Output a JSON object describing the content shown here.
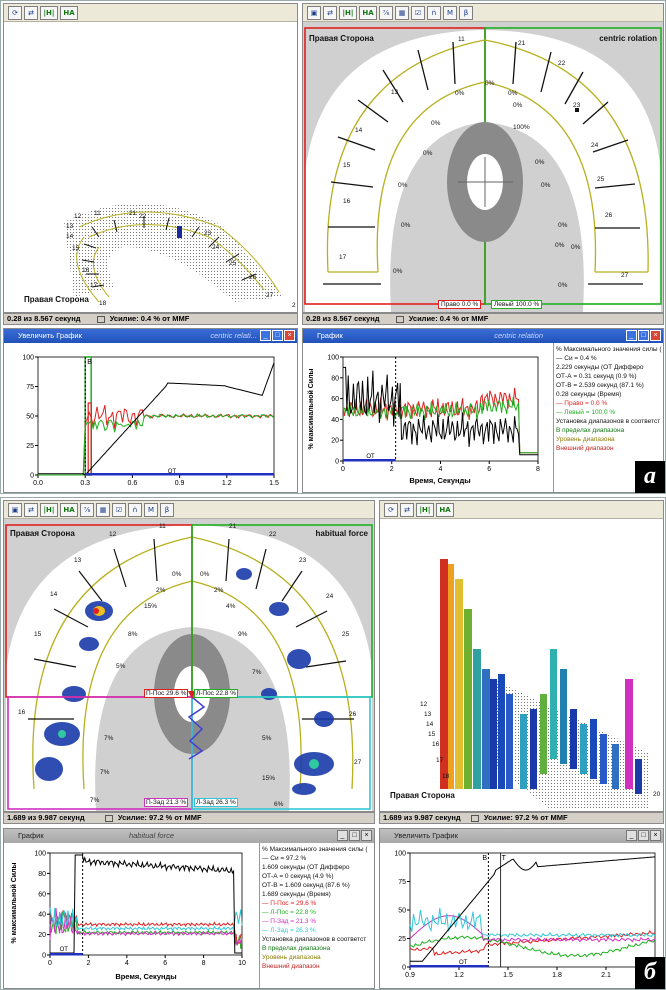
{
  "a": {
    "left_toolbar": [
      "⟳",
      "⇄",
      "|H|",
      "HA"
    ],
    "right_toolbar": [
      "▣",
      "⇄",
      "|H|",
      "HA",
      "⅞",
      "▦",
      "☑",
      "ṅ",
      "M",
      "β"
    ],
    "arch3d_label": "Правая Сторона",
    "arch3d_teeth": [
      "12",
      "11",
      "21",
      "22",
      "13",
      "23",
      "14",
      "24",
      "15",
      "25",
      "16",
      "26",
      "17",
      "27",
      "18"
    ],
    "arch3d_corner_num": "2",
    "arch_left_label": "Правая Сторона",
    "arch_right_label": "centric rolation",
    "arch_teeth": [
      "11",
      "21",
      "22",
      "13",
      "23",
      "14",
      "24",
      "15",
      "25",
      "16",
      "26",
      "17",
      "27"
    ],
    "arch_pcts": [
      "0%",
      "0%",
      "0%",
      "0%",
      "100%",
      "0%",
      "0%",
      "0%",
      "0%",
      "0%",
      "0%",
      "0%",
      "0%",
      "0%",
      "0%",
      "0%"
    ],
    "box_right": "Право 0.0 %",
    "box_left": "Левый 100.0 %",
    "status_left": {
      "time": "0.28 из 8.567 секунд",
      "force": "Усилие: 0.4 % от MMF"
    },
    "status_right": {
      "time": "0.28 из 8.567 секунд",
      "force": "Усилие: 0.4 % от MMF"
    },
    "win_zoom": {
      "title": "Увеличить График",
      "subtitle": "centric relati..."
    },
    "win_graph": {
      "title": "График",
      "subtitle": "centric relation"
    },
    "zoom_y_ticks": [
      "100",
      "75",
      "50",
      "25",
      "0"
    ],
    "zoom_x_ticks": [
      "0.0",
      "0.3",
      "0.6",
      "0.9",
      "1.2",
      "1.5"
    ],
    "zoom_marker": "B",
    "graph_y_ticks": [
      "100",
      "80",
      "60",
      "40",
      "20",
      "0"
    ],
    "graph_x_ticks": [
      "0",
      "2",
      "4",
      "6",
      "8"
    ],
    "graph_ylabel": "% максимальной Силы",
    "graph_xlabel": "Время, Секунды",
    "graph_ot": "ОТ",
    "legend": [
      "% Максимального значения силы (",
      "— Си = 0.4 %",
      "2.229 секунды (ОТ Дифферо",
      "ОТ-А = 0.31 секунд (0.9 %)",
      "ОТ-В = 2.539 секунд (87.1 %)",
      "0.28 секунды (Время)",
      "— Право = 0.0 %",
      "— Левый = 100.0 %",
      "Установка диапазонов в соответст",
      "В пределах диапазона",
      "Уровень диапазона",
      "Внешний диапазон"
    ],
    "letter": "а"
  },
  "b": {
    "left_toolbar": [
      "▣",
      "⇄",
      "|H|",
      "HA",
      "⅞",
      "▦",
      "☑",
      "ṅ",
      "M",
      "β"
    ],
    "right_toolbar": [
      "⟳",
      "⇄",
      "|H|",
      "HA"
    ],
    "arch_left_label": "Правая Сторона",
    "arch_right_label": "habitual force",
    "arch_teeth": [
      "12",
      "11",
      "21",
      "22",
      "13",
      "23",
      "14",
      "24",
      "15",
      "25",
      "16",
      "26",
      "27"
    ],
    "arch_pcts": [
      "0%",
      "0%",
      "2%",
      "2%",
      "15%",
      "4%",
      "8%",
      "9%",
      "5%",
      "7%",
      "7%",
      "5%",
      "7%",
      "15%",
      "7%",
      "6%"
    ],
    "box_pl": "П-Пос 29.6 %",
    "box_lp": "Л-Пос 22.8 %",
    "box_pz": "П-Зад 21.3 %",
    "box_lz": "Л-Зад 26.3 %",
    "arch3d_label": "Правая Сторона",
    "arch3d_teeth": [
      "12",
      "13",
      "14",
      "15",
      "16",
      "17",
      "18"
    ],
    "arch3d_corner_num": "20",
    "status_left": {
      "time": "1.689 из 9.987 секунд",
      "force": "Усилие: 97.2 % от MMF"
    },
    "status_right": {
      "time": "1.689 из 9.987 секунд",
      "force": "Усилие: 97.2 % от MMF"
    },
    "win_graph": {
      "title": "График",
      "subtitle": "habitual force"
    },
    "win_zoom": {
      "title": "Увеличить График",
      "subtitle": ""
    },
    "graph_y_ticks": [
      "100",
      "80",
      "60",
      "40",
      "20",
      "0"
    ],
    "graph_x_ticks": [
      "0",
      "2",
      "4",
      "6",
      "8",
      "10"
    ],
    "graph_ylabel": "% максимальной Силы",
    "graph_xlabel": "Время, Секунды",
    "graph_ot": "ОТ",
    "zoom_y_ticks": [
      "100",
      "75",
      "50",
      "25",
      "0"
    ],
    "zoom_x_ticks": [
      "0.9",
      "1.2",
      "1.5",
      "1.8",
      "2.1",
      "2."
    ],
    "zoom_markers": [
      "B",
      "T"
    ],
    "zoom_ot": "ОТ",
    "legend": [
      "% Максимального значения силы (",
      "— Си = 97.2 %",
      "1.609 секунды (ОТ Дифферо",
      "ОТ-А = 0 секунд (4.9 %)",
      "ОТ-В = 1.609 секунд (87.6 %)",
      "1.689 секунды (Время)",
      "— П-Пос = 29.6 %",
      "— Л-Пос = 22.8 %",
      "— П-Зад = 21.3 %",
      "— Л-Зад = 26.3 %",
      "Установка диапазонов в соответст",
      "В пределах диапазона",
      "Уровень диапазона",
      "Внешний диапазон"
    ],
    "letter": "б"
  },
  "colors": {
    "red": "#e02020",
    "green": "#20b020",
    "magenta": "#d030c0",
    "cyan": "#30c8d8",
    "black": "#000000",
    "title_blue": "#2152b8",
    "arch_yellow": "#b8b020"
  }
}
